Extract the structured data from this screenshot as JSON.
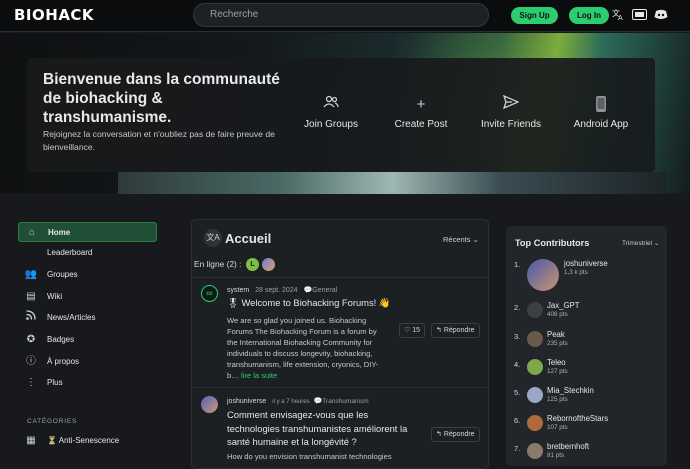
{
  "header": {
    "logo": "BIOHACK",
    "search_placeholder": "Recherche",
    "signup": "Sign Up",
    "login": "Log In",
    "icons": [
      "translate-icon",
      "keyboard-icon",
      "discord-icon"
    ]
  },
  "hero": {
    "title": "Bienvenue dans la communauté de biohacking & transhumanisme.",
    "subtitle": "Rejoignez la conversation et n'oubliez pas de faire preuve de bienveillance.",
    "actions": [
      {
        "label": "Join Groups",
        "icon": "users-icon"
      },
      {
        "label": "Create Post",
        "icon": "plus-icon"
      },
      {
        "label": "Invite Friends",
        "icon": "send-icon"
      },
      {
        "label": "Android App",
        "icon": "phone-icon"
      }
    ]
  },
  "sidebar": {
    "items": [
      {
        "label": "Home",
        "icon": "home-icon"
      },
      {
        "label": "Leaderboard",
        "icon": ""
      },
      {
        "label": "Groupes",
        "icon": "users-icon"
      },
      {
        "label": "Wiki",
        "icon": "book-icon"
      },
      {
        "label": "News/Articles",
        "icon": "rss-icon"
      },
      {
        "label": "Badges",
        "icon": "badge-icon"
      },
      {
        "label": "À propos",
        "icon": "info-icon"
      },
      {
        "label": "Plus",
        "icon": "more-icon"
      }
    ],
    "categories_heading": "CATÉGORIES",
    "category": "⏳ Anti-Senescence"
  },
  "feed": {
    "title": "Accueil",
    "sort": "Récents",
    "online_label": "En ligne (2) :",
    "posts": [
      {
        "author": "system",
        "date": "28 sept. 2024",
        "category": "General",
        "title": "🎖 Welcome to Biohacking Forums! 👋",
        "body": "We are so glad you joined us. Biohacking Forums The Biohacking Forum is a forum by the International Biohacking Community for individuals to discuss longevity, biohacking, transhumanism, life extension, cryonics, DIY-b…",
        "read_more": "lire la suite",
        "likes": "15",
        "reply": "Répondre"
      },
      {
        "author": "joshuniverse",
        "date": "il y a 7 heures",
        "category": "Transhumanism",
        "title": "Comment envisagez-vous que les technologies transhumanistes améliorent la santé humaine et la longévité ?",
        "body": "How do you envision transhumanist technologies",
        "reply": "Répondre"
      }
    ]
  },
  "contributors": {
    "title": "Top Contributors",
    "period": "Trimestriel",
    "list": [
      {
        "rank": "1.",
        "name": "joshuniverse",
        "pts": "1,3 k pts"
      },
      {
        "rank": "2.",
        "name": "Jax_GPT",
        "pts": "408 pts"
      },
      {
        "rank": "3.",
        "name": "Peak",
        "pts": "235 pts"
      },
      {
        "rank": "4.",
        "name": "Teleo",
        "pts": "127 pts"
      },
      {
        "rank": "5.",
        "name": "Mia_Stechkin",
        "pts": "125 pts"
      },
      {
        "rank": "6.",
        "name": "RebornoftheStars",
        "pts": "107 pts"
      },
      {
        "rank": "7.",
        "name": "bretbernhoft",
        "pts": "81 pts"
      }
    ]
  },
  "colors": {
    "accent": "#2ecc71",
    "background": "#17191c",
    "active_nav": "#1f4f35"
  }
}
